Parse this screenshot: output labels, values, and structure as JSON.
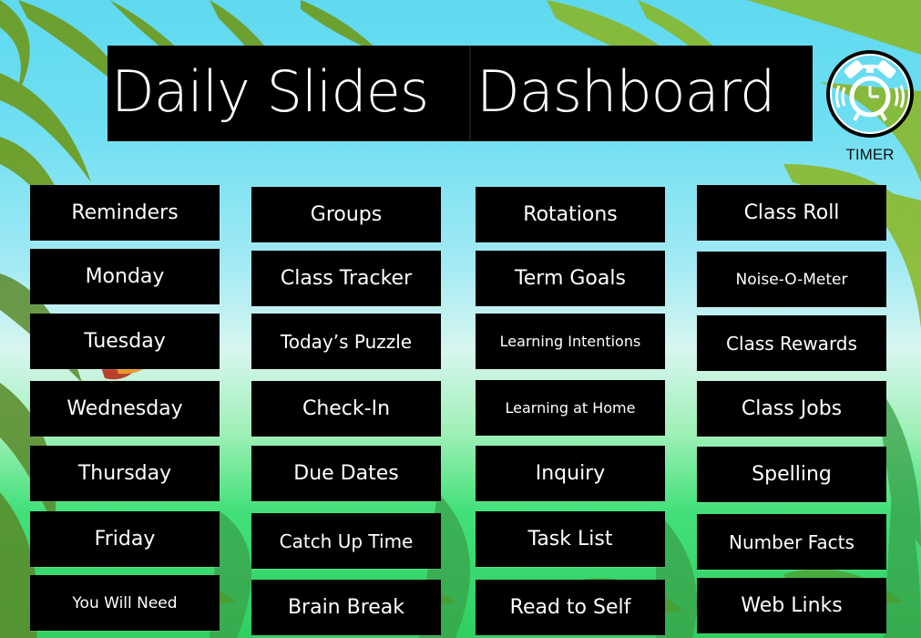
{
  "header": {
    "title_left": "Daily Slides",
    "title_right": "Dashboard"
  },
  "timer": {
    "icon": "alarm-clock-icon",
    "label": "TIMER"
  },
  "colors": {
    "tile_background": "#000000",
    "tile_text": "#ffffff",
    "sky_top": "#5fd9f0",
    "ground_bottom": "#2fcf61"
  },
  "columns": [
    {
      "tiles": [
        {
          "label": "Reminders"
        },
        {
          "label": "Monday"
        },
        {
          "label": "Tuesday"
        },
        {
          "label": "Wednesday"
        },
        {
          "label": "Thursday"
        },
        {
          "label": "Friday"
        },
        {
          "label": "You Will Need"
        }
      ]
    },
    {
      "tiles": [
        {
          "label": "Groups"
        },
        {
          "label": "Class Tracker"
        },
        {
          "label": "Today’s Puzzle"
        },
        {
          "label": "Check-In"
        },
        {
          "label": "Due Dates"
        },
        {
          "label": "Catch Up Time"
        },
        {
          "label": "Brain Break"
        }
      ]
    },
    {
      "tiles": [
        {
          "label": "Rotations"
        },
        {
          "label": "Term Goals"
        },
        {
          "label": "Learning Intentions"
        },
        {
          "label": "Learning at Home"
        },
        {
          "label": "Inquiry"
        },
        {
          "label": "Task List"
        },
        {
          "label": "Read to Self"
        }
      ]
    },
    {
      "tiles": [
        {
          "label": "Class Roll"
        },
        {
          "label": "Noise-O-Meter"
        },
        {
          "label": "Class Rewards"
        },
        {
          "label": "Class Jobs"
        },
        {
          "label": "Spelling"
        },
        {
          "label": "Number Facts"
        },
        {
          "label": "Web Links"
        }
      ]
    }
  ]
}
